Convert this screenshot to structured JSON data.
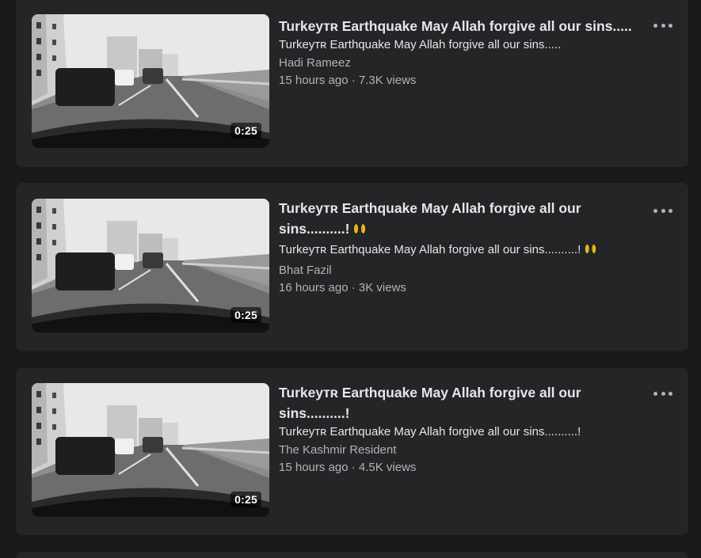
{
  "videos": [
    {
      "title": "Turkeyᴛʀ Earthquake May Allah forgive all our sins.....",
      "subtitle": "Turkeyᴛʀ Earthquake May Allah forgive all our sins.....",
      "author": "Hadi Rameez",
      "meta": "15 hours ago · 7.3K views",
      "duration": "0:25",
      "emoji_icon": ""
    },
    {
      "title": "Turkeyᴛʀ Earthquake May Allah forgive all our sins..........!",
      "subtitle": "Turkeyᴛʀ Earthquake May Allah forgive all our sins..........!",
      "author": "Bhat Fazil",
      "meta": "16 hours ago · 3K views",
      "duration": "0:25",
      "emoji_icon": "open-hands-emoji"
    },
    {
      "title": "Turkeyᴛʀ Earthquake May Allah forgive all our sins..........!",
      "subtitle": "Turkeyᴛʀ Earthquake May Allah forgive all our sins..........!",
      "author": "The Kashmir Resident",
      "meta": "15 hours ago · 4.5K views",
      "duration": "0:25",
      "emoji_icon": ""
    }
  ],
  "colors": {
    "page_bg": "#18191a",
    "card_bg": "#242526",
    "primary_text": "#e4e6eb",
    "secondary_text": "#b0b3b8"
  }
}
